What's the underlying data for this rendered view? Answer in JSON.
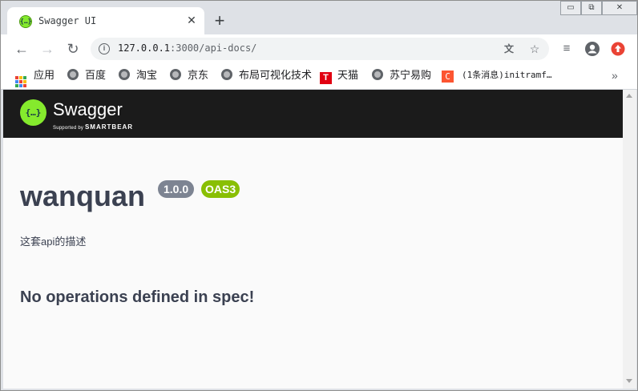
{
  "window": {
    "tab_title": "Swagger UI",
    "controls": {
      "minimize": "▭",
      "restore": "⧉",
      "close": "✕"
    }
  },
  "toolbar": {
    "url_host": "127.0.0.1",
    "url_port": ":3000",
    "url_path": "/api-docs/"
  },
  "bookmarks": {
    "items": [
      "应用",
      "百度",
      "淘宝",
      "京东",
      "布局可视化技术",
      "天猫",
      "苏宁易购",
      "(1条消息)initramf…"
    ],
    "more": "»"
  },
  "swagger": {
    "brand": "Swagger",
    "supported_by": "Supported by",
    "smartbear": "SMARTBEAR",
    "title": "wanquan",
    "version": "1.0.0",
    "oas": "OAS3",
    "description": "这套api的描述",
    "no_operations": "No operations defined in spec!"
  },
  "colors": {
    "topbar": "#1b1b1b",
    "swagger_green": "#85ea2d",
    "version_badge": "#7d8492",
    "oas_badge": "#89bf04",
    "text": "#3b4151"
  }
}
